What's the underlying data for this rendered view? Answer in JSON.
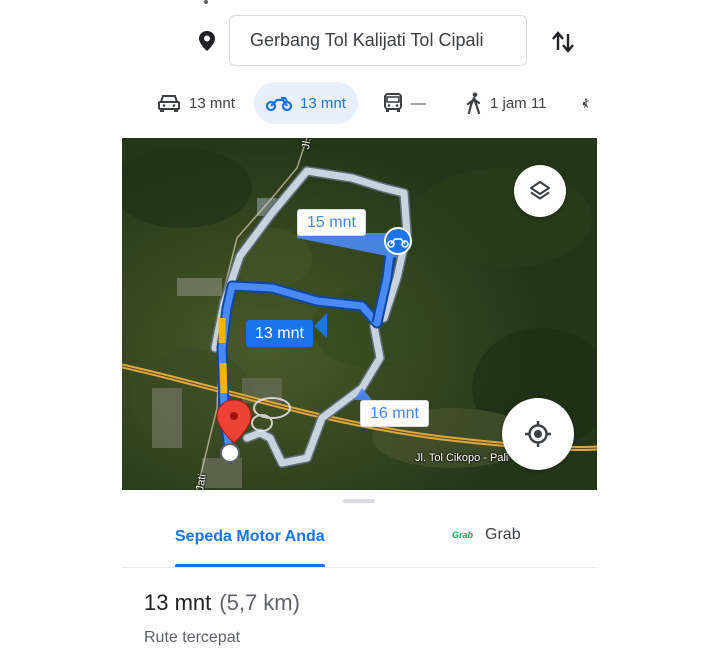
{
  "search": {
    "destination": "Gerbang Tol Kalijati Tol Cipali",
    "icons": [
      "more-dots-icon",
      "location-pin-icon",
      "swap-icon"
    ]
  },
  "modes": [
    {
      "name": "car",
      "icon": "car-icon",
      "label": "13 mnt"
    },
    {
      "name": "motorcycle",
      "icon": "motorcycle-icon",
      "label": "13 mnt",
      "selected": true
    },
    {
      "name": "transit",
      "icon": "bus-icon",
      "label": "—"
    },
    {
      "name": "walk",
      "icon": "walk-icon",
      "label": "1 jam 11"
    },
    {
      "name": "ride",
      "icon": "ride-icon",
      "label": ""
    }
  ],
  "map": {
    "routes": [
      {
        "label": "15 mnt",
        "type": "alternative"
      },
      {
        "label": "13 mnt",
        "type": "selected"
      },
      {
        "label": "16 mnt",
        "type": "alternative"
      }
    ],
    "road_labels": [
      "Jl. Ra",
      "Jl. Tol Cikopo - Pali",
      "Jati"
    ],
    "controls": [
      "layers-icon",
      "my-location-icon"
    ]
  },
  "sheet": {
    "tabs": {
      "own": "Sepeda Motor Anda",
      "grab_logo": "Grab",
      "grab": "Grab"
    },
    "summary": {
      "duration": "13 mnt",
      "distance": "(5,7 km)",
      "subtitle": "Rute tercepat"
    }
  },
  "colors": {
    "accent": "#1a73e8",
    "route_alt": "#c5d0dc",
    "traffic": "#f4b400",
    "pin": "#ea4335",
    "grab": "#00b14f"
  }
}
